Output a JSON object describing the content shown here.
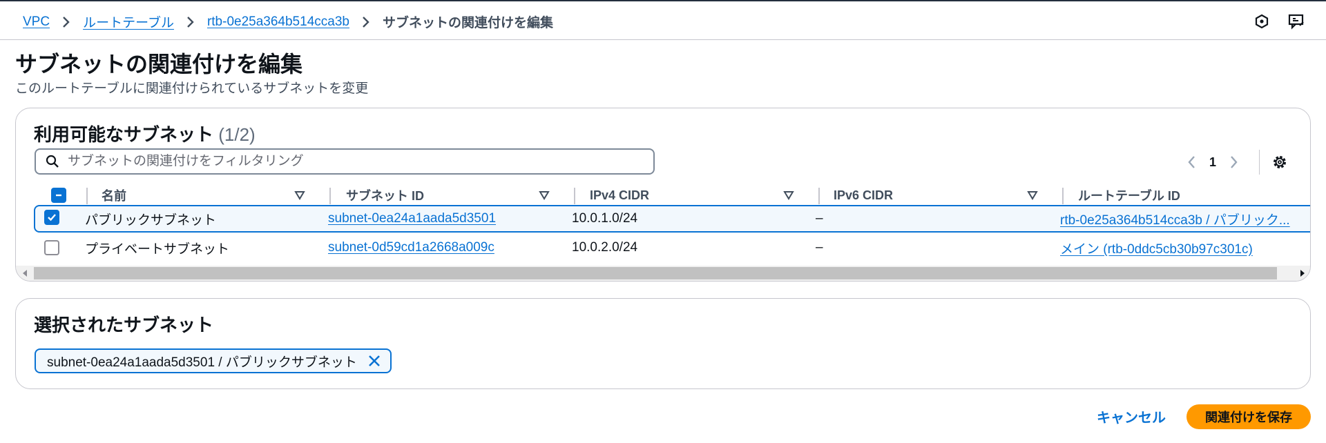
{
  "breadcrumb": {
    "items": [
      "VPC",
      "ルートテーブル",
      "rtb-0e25a364b514cca3b"
    ],
    "current": "サブネットの関連付けを編集"
  },
  "header": {
    "icons": [
      "info-hexagon-icon",
      "feedback-icon"
    ]
  },
  "page": {
    "title": "サブネットの関連付けを編集",
    "description": "このルートテーブルに関連付けられているサブネットを変更"
  },
  "available": {
    "heading": "利用可能なサブネット",
    "count": "(1/2)",
    "filter_placeholder": "サブネットの関連付けをフィルタリング",
    "page_number": "1",
    "columns": [
      "名前",
      "サブネット ID",
      "IPv4 CIDR",
      "IPv6 CIDR",
      "ルートテーブル ID"
    ],
    "rows": [
      {
        "selected": true,
        "name": "パブリックサブネット",
        "subnet_id": "subnet-0ea24a1aada5d3501",
        "ipv4": "10.0.1.0/24",
        "ipv6": "–",
        "route_table": "rtb-0e25a364b514cca3b / パブリック..."
      },
      {
        "selected": false,
        "name": "プライベートサブネット",
        "subnet_id": "subnet-0d59cd1a2668a009c",
        "ipv4": "10.0.2.0/24",
        "ipv6": "–",
        "route_table": "メイン (rtb-0ddc5cb30b97c301c)"
      }
    ]
  },
  "selected": {
    "heading": "選択されたサブネット",
    "tokens": [
      "subnet-0ea24a1aada5d3501 / パブリックサブネット"
    ]
  },
  "actions": {
    "cancel": "キャンセル",
    "save": "関連付けを保存"
  },
  "colors": {
    "link": "#0972d3",
    "primary_button": "#ff9900",
    "border": "#c6c6cd"
  }
}
